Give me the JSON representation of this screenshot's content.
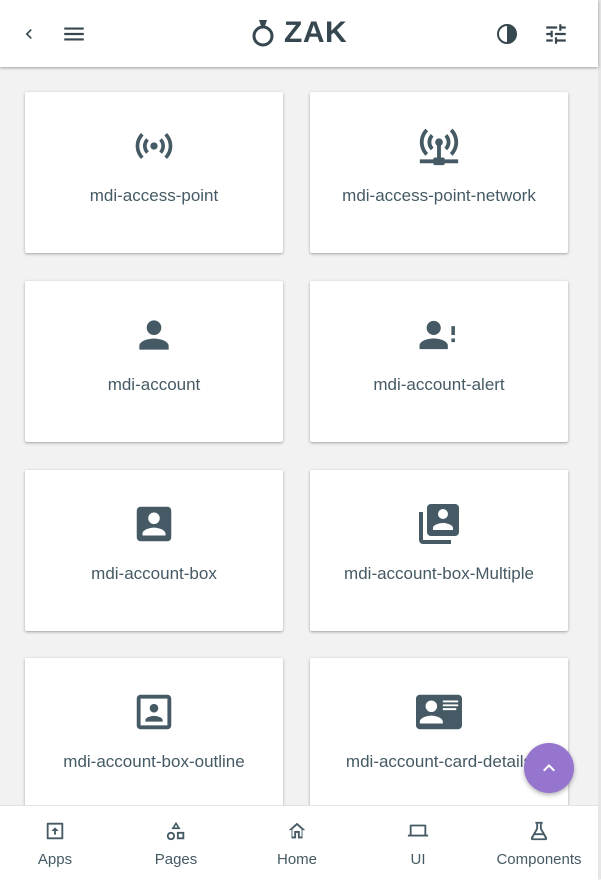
{
  "header": {
    "brand": "ZAK",
    "icons": [
      "chevron-left-icon",
      "menu-icon",
      "ring-logo-icon",
      "contrast-icon",
      "tune-icon"
    ]
  },
  "cards": [
    {
      "icon": "mdi-access-point",
      "label": "mdi-access-point"
    },
    {
      "icon": "mdi-access-point-network",
      "label": "mdi-access-point-network"
    },
    {
      "icon": "mdi-account",
      "label": "mdi-account"
    },
    {
      "icon": "mdi-account-alert",
      "label": "mdi-account-alert"
    },
    {
      "icon": "mdi-account-box",
      "label": "mdi-account-box"
    },
    {
      "icon": "mdi-account-box-multiple",
      "label": "mdi-account-box-Multiple"
    },
    {
      "icon": "mdi-account-box-outline",
      "label": "mdi-account-box-outline"
    },
    {
      "icon": "mdi-account-card-details",
      "label": "mdi-account-card-details"
    }
  ],
  "fab": {
    "icon": "chevron-up-icon"
  },
  "bottom_nav": [
    {
      "icon": "apps-upload-icon",
      "label": "Apps"
    },
    {
      "icon": "shapes-icon",
      "label": "Pages"
    },
    {
      "icon": "home-icon",
      "label": "Home"
    },
    {
      "icon": "laptop-icon",
      "label": "UI"
    },
    {
      "icon": "flask-icon",
      "label": "Components"
    }
  ],
  "colors": {
    "icon": "#455a64",
    "fab": "#9575cd",
    "background": "#f2f2f2"
  }
}
